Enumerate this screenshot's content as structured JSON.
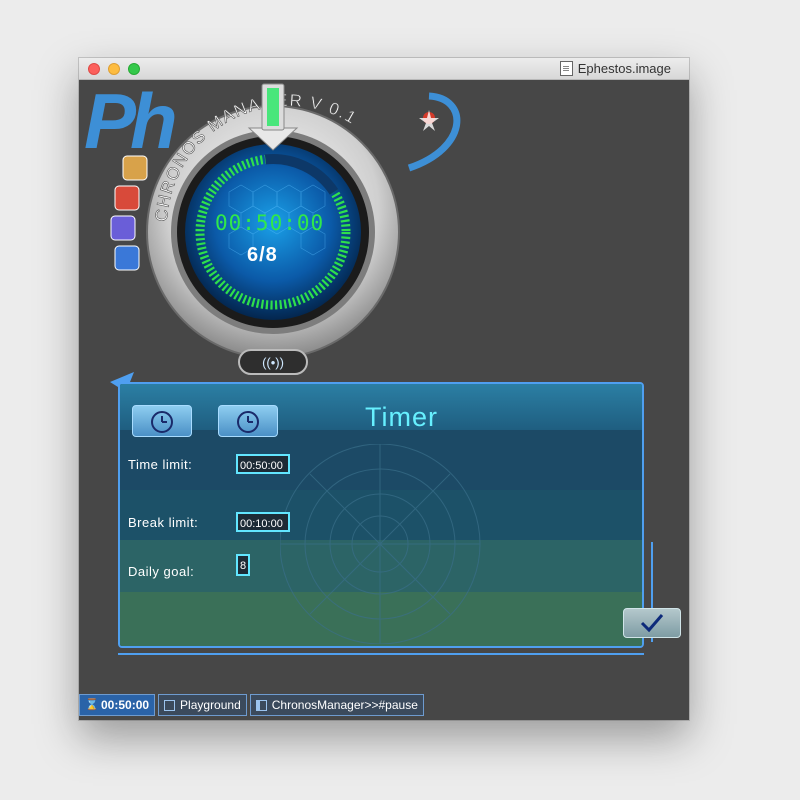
{
  "window": {
    "title": "Ephestos.image"
  },
  "logo": {
    "text": "Ph"
  },
  "gauge": {
    "ring_text": "CHRONOS MANAGER V 0.1",
    "time": "00:50:00",
    "count": "6/8"
  },
  "panel": {
    "title": "Timer",
    "fields": [
      {
        "label": "Time limit:",
        "value": "00:50:00"
      },
      {
        "label": "Break limit:",
        "value": "00:10:00"
      },
      {
        "label": "Daily goal:",
        "value": "8"
      }
    ]
  },
  "taskbar": {
    "items": [
      {
        "label": "00:50:00",
        "icon": "hourglass-icon"
      },
      {
        "label": "Playground",
        "icon": "window-icon"
      },
      {
        "label": "ChronosManager>>#pause",
        "icon": "browser-icon"
      }
    ]
  },
  "colors": {
    "window_bg": "#474747",
    "accent_blue": "#4f9ff0",
    "digital_green": "#30e84a",
    "title_cyan": "#67f0ff"
  }
}
